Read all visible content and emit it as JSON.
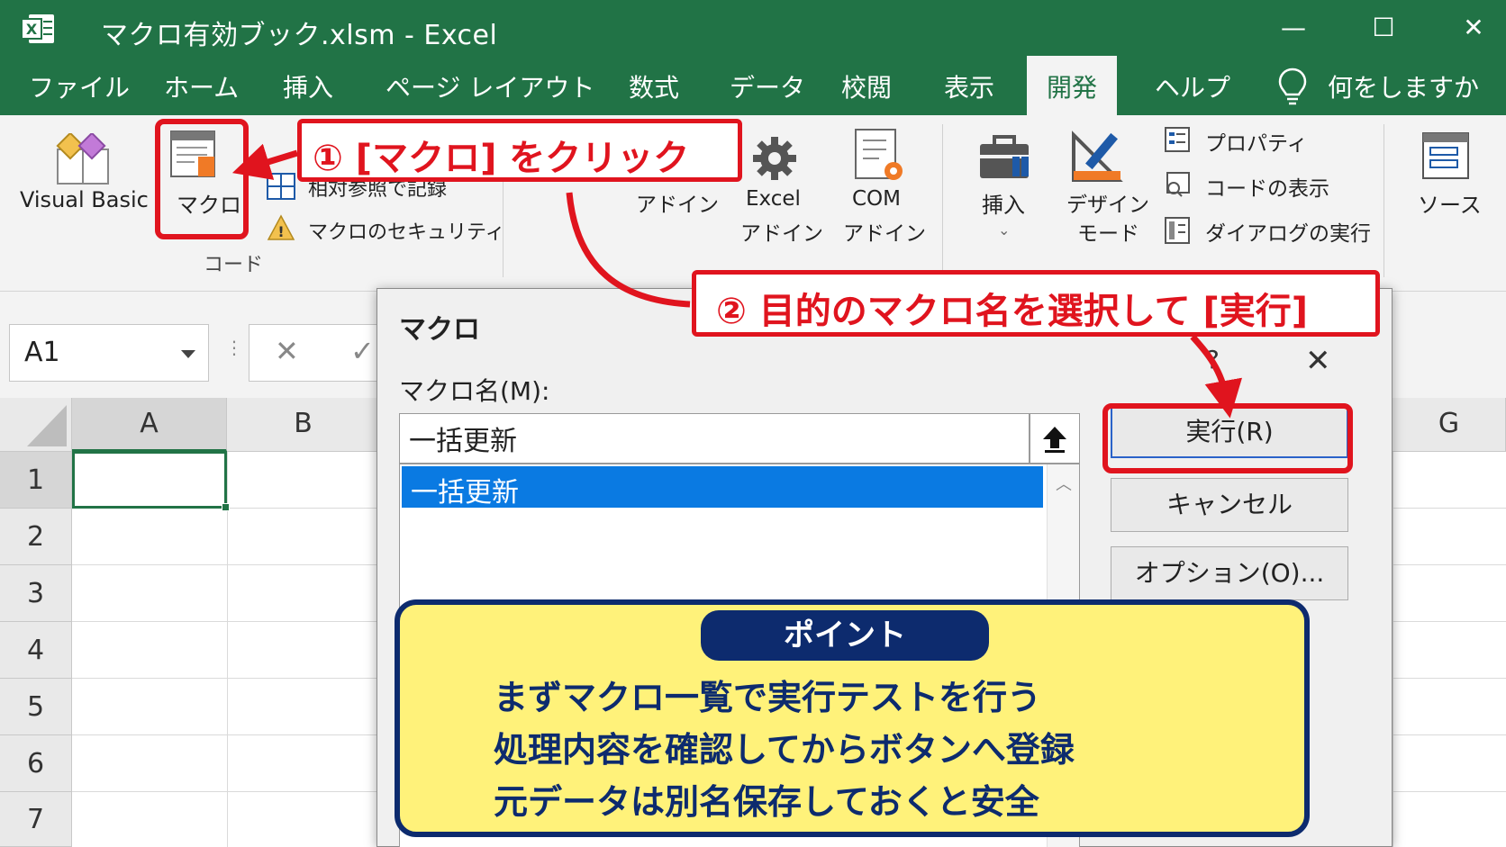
{
  "window": {
    "title": "マクロ有効ブック.xlsm  -  Excel",
    "controls": [
      "—",
      "☐",
      "✕"
    ]
  },
  "tabs": [
    "ファイル",
    "ホーム",
    "挿入",
    "ページ レイアウト",
    "数式",
    "データ",
    "校閲",
    "表示",
    "開発",
    "ヘルプ"
  ],
  "active_tab": "開発",
  "tell_me": "何をしますか",
  "ribbon": {
    "code_group": {
      "visual_basic": "Visual Basic",
      "macro": "マクロ",
      "relative_record": "相対参照で記録",
      "macro_security": "マクロのセキュリティ",
      "group_label": "コード"
    },
    "addins_group": {
      "addins": "アドイン",
      "excel_addins_line1": "Excel",
      "excel_addins_line2": "アドイン",
      "com_addins_line1": "COM",
      "com_addins_line2": "アドイン"
    },
    "controls_group": {
      "insert": "挿入",
      "design_mode_line1": "デザイン",
      "design_mode_line2": "モード",
      "properties": "プロパティ",
      "view_code": "コードの表示",
      "run_dialog": "ダイアログの実行"
    },
    "xml_group": {
      "source": "ソース"
    }
  },
  "formula_bar": {
    "name_box": "A1",
    "cancel": "✕",
    "enter": "✓"
  },
  "grid": {
    "columns": [
      "A",
      "B",
      "G"
    ],
    "rows": [
      "1",
      "2",
      "3",
      "4",
      "5",
      "6",
      "7"
    ]
  },
  "dialog": {
    "title": "マクロ",
    "help": "?",
    "close": "✕",
    "name_label": "マクロ名(M):",
    "name_value": "一括更新",
    "macros": [
      "一括更新"
    ],
    "buttons": {
      "run": "実行(R)",
      "cancel": "キャンセル",
      "options": "オプション(O)..."
    }
  },
  "annotations": {
    "step1": "① [マクロ] をクリック",
    "step2": "② 目的のマクロ名を選択して [実行]",
    "point_title": "ポイント",
    "point_lines": [
      "まずマクロ一覧で実行テストを行う",
      "処理内容を確認してからボタンへ登録",
      "元データは別名保存しておくと安全"
    ]
  },
  "colors": {
    "excel_green": "#217346",
    "annotation_red": "#e0141e",
    "point_yellow": "#fff27a",
    "point_navy": "#0d2b6e",
    "selection_blue": "#0a7ae2"
  }
}
